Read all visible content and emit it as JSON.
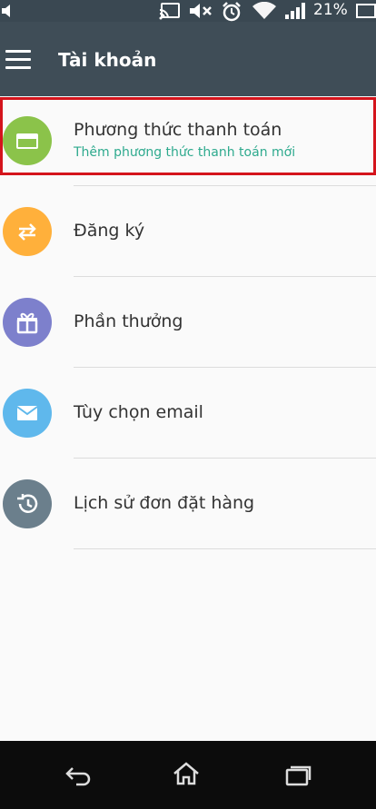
{
  "status_bar": {
    "battery": "21%",
    "icons": [
      "cast-icon",
      "mute-icon",
      "alarm-icon",
      "wifi-icon",
      "signal-icon",
      "battery-icon"
    ]
  },
  "header": {
    "title": "Tài khoản",
    "menu_icon": "hamburger-menu-icon"
  },
  "menu": [
    {
      "label": "Phương thức thanh toán",
      "sublabel": "Thêm phương thức thanh toán mới",
      "icon": "credit-card-icon",
      "color": "#8bc34a",
      "highlighted": true
    },
    {
      "label": "Đăng ký",
      "icon": "repeat-icon",
      "color": "#ffb03b"
    },
    {
      "label": "Phần thưởng",
      "icon": "gift-icon",
      "color": "#7d80cc"
    },
    {
      "label": "Tùy chọn email",
      "icon": "email-icon",
      "color": "#5fb8ec"
    },
    {
      "label": "Lịch sử đơn đặt hàng",
      "icon": "history-icon",
      "color": "#6b7f8c"
    }
  ],
  "nav_bar": {
    "buttons": [
      "back-icon",
      "home-icon",
      "recent-apps-icon"
    ]
  },
  "colors": {
    "header_bg": "#3f4d57",
    "highlight_border": "#d4141c",
    "sublabel": "#2eaa8e"
  }
}
